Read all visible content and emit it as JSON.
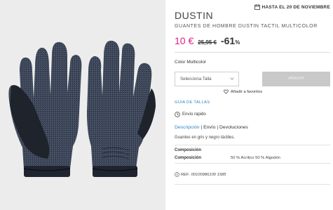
{
  "delivery": {
    "deadline": "HASTA EL 20 DE NOVIEMBRE",
    "icon": "calendar-icon"
  },
  "product": {
    "brand": "DUSTIN",
    "name": "GUANTES DE HOMBRE DUSTIN TACTIL MULTICOLOR",
    "price_current": "10 €",
    "price_original": "25,95 €",
    "discount": "-61",
    "discount_unit": "%",
    "image_alt": "Guantes de hombre Dustin táctil",
    "image_icon": "gloves-image"
  },
  "options": {
    "color_label": "Color Multicolor",
    "size_placeholder": "Selecciona Talla",
    "add_button": "AÑADIR",
    "favorites": "Añadir a favoritos"
  },
  "links": {
    "size_guide": "GUIA DE TALLAS"
  },
  "shipping": {
    "label": "Envío rápido",
    "icon": "clock-icon"
  },
  "tabs": [
    {
      "label": "Descripción",
      "active": true
    },
    {
      "label": "Envío",
      "active": false
    },
    {
      "label": "Devoluciones",
      "active": false
    }
  ],
  "description": "Guantes en gris y negro táctiles.",
  "composition": {
    "heading": "Composición",
    "label": "Composición",
    "value": "50 % Acrílico 50 % Algodón"
  },
  "reference": {
    "prefix": "REF.",
    "number": "00100986100 1585"
  },
  "colors": {
    "accent": "#e0218a",
    "link": "#2a85c7",
    "button_disabled": "#c9c9c9",
    "image_bg": "#ececec"
  }
}
